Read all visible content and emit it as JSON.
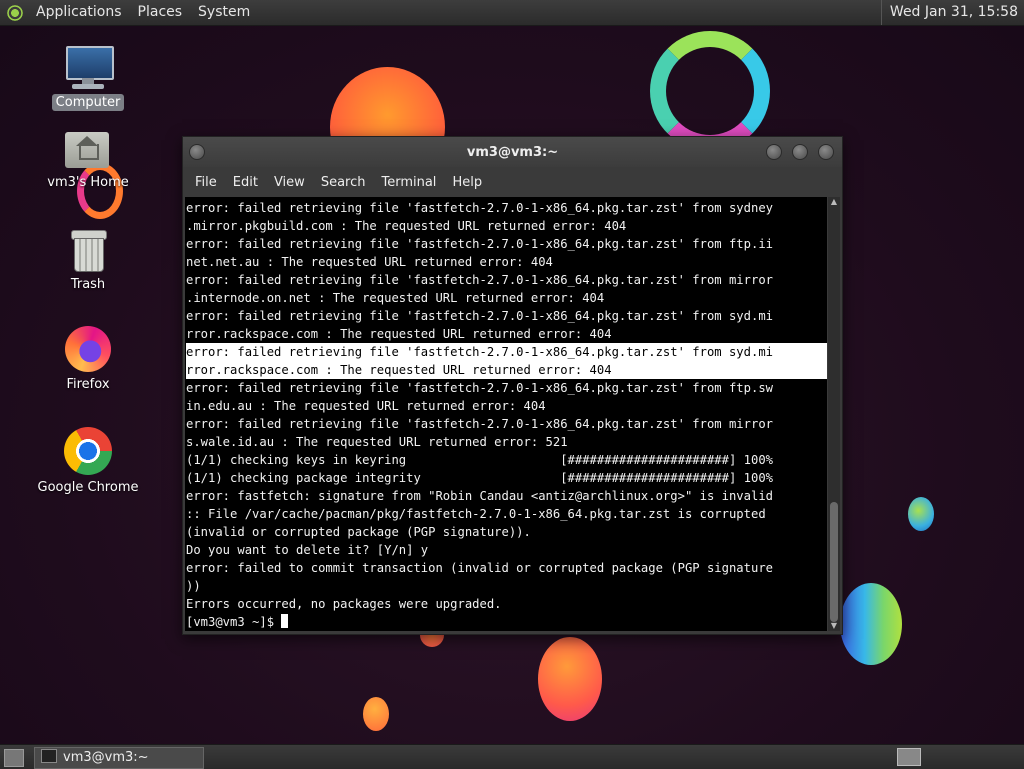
{
  "top_panel": {
    "menus": [
      "Applications",
      "Places",
      "System"
    ],
    "clock": "Wed Jan 31, 15:58"
  },
  "desktop_icons": [
    {
      "label": "Computer",
      "icon": "computer-icon"
    },
    {
      "label": "vm3's Home",
      "icon": "home-folder-icon"
    },
    {
      "label": "Trash",
      "icon": "trash-icon"
    },
    {
      "label": "Firefox",
      "icon": "firefox-icon"
    },
    {
      "label": "Google Chrome",
      "icon": "chrome-icon"
    }
  ],
  "terminal": {
    "title": "vm3@vm3:~",
    "menu": [
      "File",
      "Edit",
      "View",
      "Search",
      "Terminal",
      "Help"
    ],
    "lines": [
      "error: failed retrieving file 'fastfetch-2.7.0-1-x86_64.pkg.tar.zst' from sydney",
      ".mirror.pkgbuild.com : The requested URL returned error: 404",
      "error: failed retrieving file 'fastfetch-2.7.0-1-x86_64.pkg.tar.zst' from ftp.ii",
      "net.net.au : The requested URL returned error: 404",
      "error: failed retrieving file 'fastfetch-2.7.0-1-x86_64.pkg.tar.zst' from mirror",
      ".internode.on.net : The requested URL returned error: 404",
      "error: failed retrieving file 'fastfetch-2.7.0-1-x86_64.pkg.tar.zst' from syd.mi",
      "rror.rackspace.com : The requested URL returned error: 404",
      "error: failed retrieving file 'fastfetch-2.7.0-1-x86_64.pkg.tar.zst' from syd.mi",
      "rror.rackspace.com : The requested URL returned error: 404",
      "error: failed retrieving file 'fastfetch-2.7.0-1-x86_64.pkg.tar.zst' from ftp.sw",
      "in.edu.au : The requested URL returned error: 404",
      "error: failed retrieving file 'fastfetch-2.7.0-1-x86_64.pkg.tar.zst' from mirror",
      "s.wale.id.au : The requested URL returned error: 521",
      "(1/1) checking keys in keyring                     [######################] 100%",
      "(1/1) checking package integrity                   [######################] 100%",
      "error: fastfetch: signature from \"Robin Candau <antiz@archlinux.org>\" is invalid",
      ":: File /var/cache/pacman/pkg/fastfetch-2.7.0-1-x86_64.pkg.tar.zst is corrupted",
      "(invalid or corrupted package (PGP signature)).",
      "Do you want to delete it? [Y/n] y",
      "error: failed to commit transaction (invalid or corrupted package (PGP signature",
      "))",
      "Errors occurred, no packages were upgraded."
    ],
    "highlighted_lines": [
      8,
      9
    ],
    "prompt": "[vm3@vm3 ~]$ "
  },
  "taskbar": {
    "task_label": "vm3@vm3:~"
  }
}
